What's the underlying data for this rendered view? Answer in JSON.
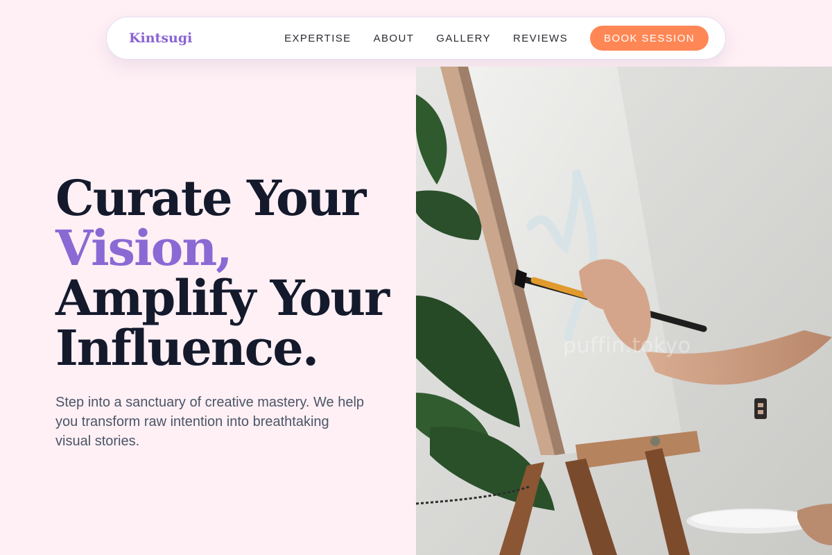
{
  "brand": {
    "name": "Kintsugi",
    "color": "#8a63d2"
  },
  "nav": {
    "links": [
      "EXPERTISE",
      "ABOUT",
      "GALLERY",
      "REVIEWS"
    ],
    "cta_label": "BOOK SESSION",
    "cta_color": "#ff8755"
  },
  "hero": {
    "headline_line1": "Curate Your",
    "headline_line2": "Vision,",
    "headline_line3": "Amplify Your",
    "headline_line4": "Influence.",
    "accent_color": "#8b69d4",
    "subtitle": "Step into a sanctuary of creative mastery. We help you transform raw intention into breathtaking visual stories."
  },
  "image": {
    "subject": "painter-at-easel-photo",
    "watermark": "puffin.tokyo"
  }
}
